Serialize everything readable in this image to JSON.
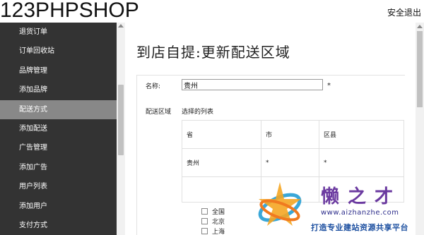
{
  "header": {
    "logo": "123PHPSHOP",
    "logout_label": "安全退出"
  },
  "sidebar": {
    "items": [
      {
        "label": "退货订单",
        "active": false
      },
      {
        "label": "订单回收站",
        "active": false
      },
      {
        "label": "品牌管理",
        "active": false
      },
      {
        "label": "添加品牌",
        "active": false
      },
      {
        "label": "配送方式",
        "active": true
      },
      {
        "label": "添加配送",
        "active": false
      },
      {
        "label": "广告管理",
        "active": false
      },
      {
        "label": "添加广告",
        "active": false
      },
      {
        "label": "用户列表",
        "active": false
      },
      {
        "label": "添加用户",
        "active": false
      },
      {
        "label": "支付方式",
        "active": false
      }
    ]
  },
  "main": {
    "title": "到店自提:更新配送区域",
    "form": {
      "name_label": "名称:",
      "name_value": "贵州",
      "required_mark": "*",
      "region_label": "配送区域",
      "selected_list_label": "选择的列表",
      "table": {
        "headers": [
          "省",
          "市",
          "区县"
        ],
        "rows": [
          [
            "贵州",
            "*",
            "*"
          ]
        ]
      },
      "checklist": [
        "全国",
        "北京",
        "上海"
      ]
    }
  },
  "watermark": {
    "title": "懒之才",
    "url": "www.aizhanzhe.com",
    "slogan": "打造专业建站资源共享平台"
  },
  "colors": {
    "sidebar_bg": "#333333",
    "sidebar_active": "#888888",
    "watermark_purple": "#6b3aa0"
  }
}
